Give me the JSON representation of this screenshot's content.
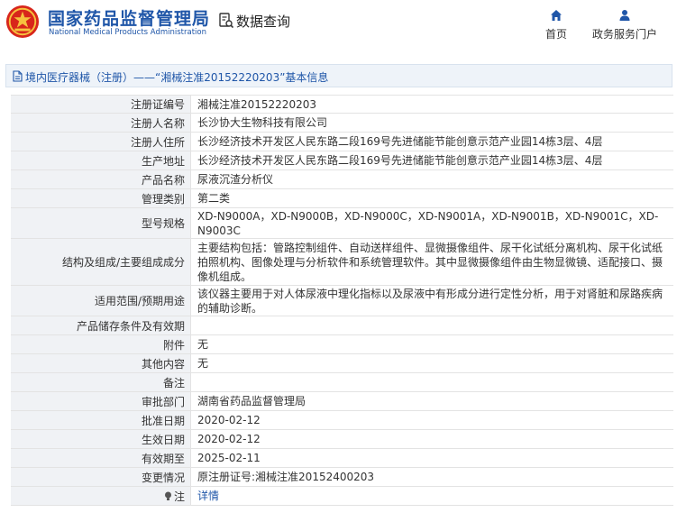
{
  "header": {
    "brand_cn": "国家药品监督管理局",
    "brand_en": "National Medical Products Administration",
    "page_title": "数据查询",
    "nav": [
      {
        "label": "首页",
        "icon": "home-icon"
      },
      {
        "label": "政务服务门户",
        "icon": "user-icon"
      }
    ]
  },
  "breadcrumb": {
    "text": "境内医疗器械（注册）——“湘械注准20152220203”基本信息"
  },
  "record": [
    {
      "label": "注册证编号",
      "value": "湘械注准20152220203"
    },
    {
      "label": "注册人名称",
      "value": "长沙协大生物科技有限公司"
    },
    {
      "label": "注册人住所",
      "value": "长沙经济技术开发区人民东路二段169号先进储能节能创意示范产业园14栋3层、4层"
    },
    {
      "label": "生产地址",
      "value": "长沙经济技术开发区人民东路二段169号先进储能节能创意示范产业园14栋3层、4层"
    },
    {
      "label": "产品名称",
      "value": "尿液沉渣分析仪"
    },
    {
      "label": "管理类别",
      "value": "第二类"
    },
    {
      "label": "型号规格",
      "value": "XD-N9000A，XD-N9000B，XD-N9000C，XD-N9001A，XD-N9001B，XD-N9001C，XD-N9003C"
    },
    {
      "label": "结构及组成/主要组成成分",
      "value": "主要结构包括：管路控制组件、自动送样组件、显微摄像组件、尿干化试纸分离机构、尿干化试纸拍照机构、图像处理与分析软件和系统管理软件。其中显微摄像组件由生物显微镜、适配接口、摄像机组成。"
    },
    {
      "label": "适用范围/预期用途",
      "value": "该仪器主要用于对人体尿液中理化指标以及尿液中有形成分进行定性分析，用于对肾脏和尿路疾病的辅助诊断。"
    },
    {
      "label": "产品储存条件及有效期",
      "value": ""
    },
    {
      "label": "附件",
      "value": "无"
    },
    {
      "label": "其他内容",
      "value": "无"
    },
    {
      "label": "备注",
      "value": ""
    },
    {
      "label": "审批部门",
      "value": "湖南省药品监督管理局"
    },
    {
      "label": "批准日期",
      "value": "2020-02-12"
    },
    {
      "label": "生效日期",
      "value": "2020-02-12"
    },
    {
      "label": "有效期至",
      "value": "2025-02-11"
    },
    {
      "label": "变更情况",
      "value": "原注册证号:湘械注准20152400203"
    },
    {
      "label": "注",
      "value": "详情",
      "icon": "lightbulb-icon"
    }
  ],
  "colors": {
    "brand": "#1f56a8",
    "label_bg": "#f0f2f5",
    "crumb_bg": "#eef3f9",
    "emblem_red": "#d8261b"
  }
}
